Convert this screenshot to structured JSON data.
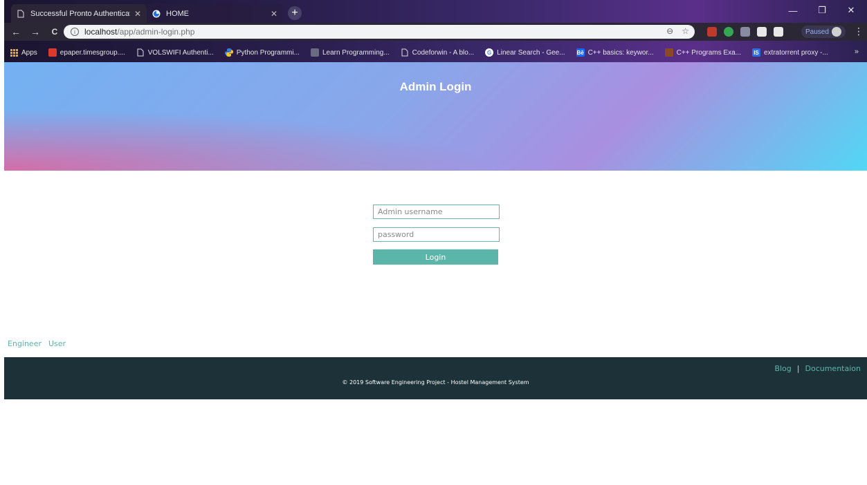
{
  "browser": {
    "tabs": [
      {
        "title": "Successful Pronto Authentication",
        "icon": "page-icon",
        "active": false
      },
      {
        "title": "HOME",
        "icon": "site-favicon",
        "active": true
      }
    ],
    "new_tab_icon": "+",
    "window_controls": {
      "minimize": "—",
      "maximize": "❐",
      "close": "✕"
    },
    "nav": {
      "back": "←",
      "forward": "→",
      "reload": "C"
    },
    "url": {
      "host": "localhost",
      "path": "/app/admin-login.php",
      "info_icon": "i"
    },
    "omnibox_icons": {
      "zoom": "⊖",
      "bookmark": "☆"
    },
    "profile_label": "Paused",
    "bookmarks": [
      {
        "label": "Apps",
        "icon": "apps-grid-icon",
        "color": "#e8a33b"
      },
      {
        "label": "epaper.timesgroup....",
        "icon": "epaper-icon",
        "color": "#d83b2b"
      },
      {
        "label": "VOLSWIFI Authenti...",
        "icon": "page-icon",
        "color": "#2b2734"
      },
      {
        "label": "Python Programmi...",
        "icon": "python-icon",
        "color": "#3a7bd5"
      },
      {
        "label": "Learn Programming...",
        "icon": "learn-icon",
        "color": "#6a6a80"
      },
      {
        "label": "Codeforwin - A blo...",
        "icon": "page-icon",
        "color": "#2b2734"
      },
      {
        "label": "Linear Search - Gee...",
        "icon": "google-icon",
        "color": "#4285f4"
      },
      {
        "label": "C++ basics: keywor...",
        "icon": "behance-icon",
        "color": "#1769ff"
      },
      {
        "label": "C++ Programs Exa...",
        "icon": "cpp-icon",
        "color": "#8a4a2a"
      },
      {
        "label": "extratorrent proxy -...",
        "icon": "is-icon",
        "color": "#2a6ee0"
      }
    ],
    "bookmarks_more": "»"
  },
  "page": {
    "hero_title": "Admin Login",
    "form": {
      "username_placeholder": "Admin username",
      "password_placeholder": "password",
      "login_label": "Login"
    },
    "quick_links": [
      "Engineer",
      "User"
    ],
    "footer": {
      "links": [
        "Blog",
        "Documentaion"
      ],
      "separator": "|",
      "copyright": "© 2019 Software Engineering Project - Hostel Management System"
    }
  },
  "colors": {
    "accent": "#5bb5a8",
    "footer_bg": "#1d3238"
  }
}
